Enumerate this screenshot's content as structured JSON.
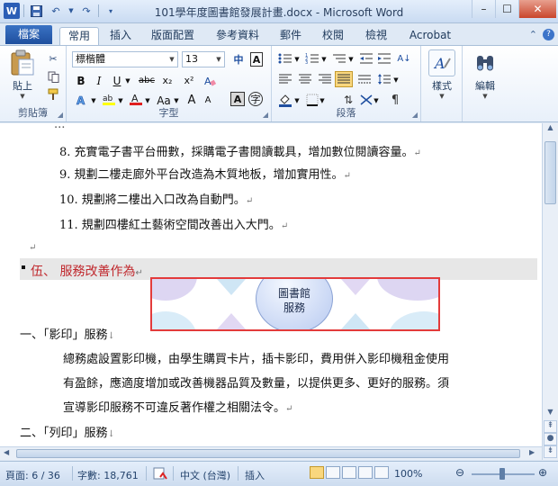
{
  "window": {
    "title": "101學年度圖書館發展計畫.docx - Microsoft Word",
    "app_icon": "W"
  },
  "tabs": {
    "file": "檔案",
    "items": [
      "常用",
      "插入",
      "版面配置",
      "參考資料",
      "郵件",
      "校閱",
      "檢視",
      "Acrobat"
    ],
    "active": "常用"
  },
  "ribbon": {
    "clipboard": {
      "paste_label": "貼上",
      "group_label": "剪貼簿"
    },
    "font": {
      "font_name": "標楷體",
      "font_size": "13",
      "group_label": "字型"
    },
    "paragraph": {
      "group_label": "段落"
    },
    "styles": {
      "label": "樣式"
    },
    "editing": {
      "label": "編輯"
    }
  },
  "document": {
    "top_partial": "...",
    "list_items": [
      "8. 充實電子書平台冊數，採購電子書閱讀載具，增加數位閱讀容量。",
      "9. 規劃二樓走廊外平台改造為木質地板，增加實用性。",
      "10. 規劃將二樓出入口改為自動門。",
      "11. 規劃四樓紅土藝術空間改善出入大門。"
    ],
    "section_heading": "伍、 服務改善作為",
    "diagram_center": [
      "圖書館",
      "服務"
    ],
    "sub1_title": "一、「影印」服務",
    "sub1_lines": [
      "總務處設置影印機，由學生購買卡片，插卡影印，費用併入影印機租金使用",
      "有盈餘，應適度增加或改善機器品質及數量，以提供更多、更好的服務。須",
      "宣導影印服務不可違反著作權之相關法令。"
    ],
    "sub2_title": "二、「列印」服務"
  },
  "status": {
    "page": "頁面: 6 / 36",
    "words": "字數: 18,761",
    "language": "中文 (台灣)",
    "mode": "插入",
    "zoom": "100%",
    "zoom_level": 1.0
  }
}
